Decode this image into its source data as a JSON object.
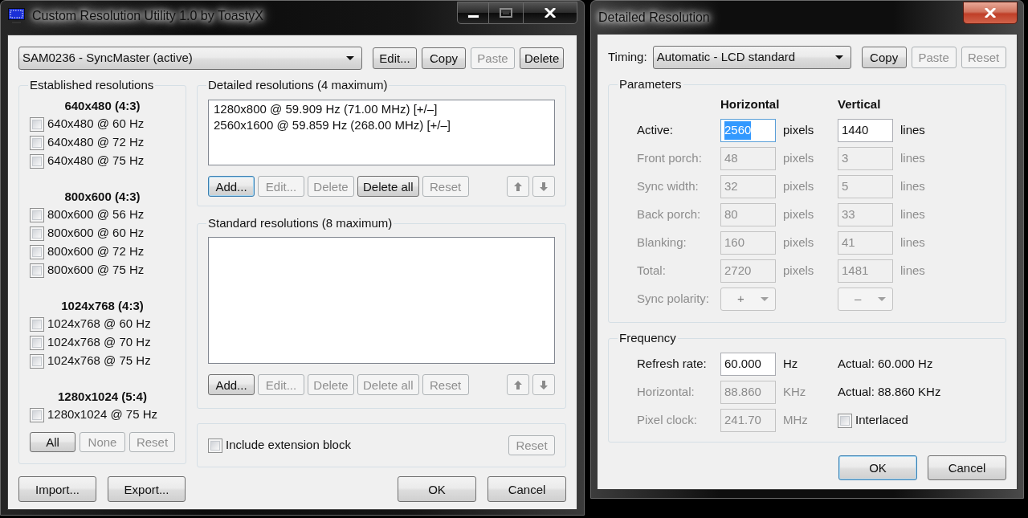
{
  "main_window": {
    "title": "Custom Resolution Utility 1.0 by ToastyX",
    "monitor_select": {
      "value": "SAM0236 - SyncMaster (active)"
    },
    "monitor_buttons": [
      {
        "label": "Edit...",
        "disabled": false
      },
      {
        "label": "Copy",
        "disabled": false
      },
      {
        "label": "Paste",
        "disabled": true
      },
      {
        "label": "Delete",
        "disabled": false
      }
    ],
    "established": {
      "title": "Established resolutions",
      "groups": [
        {
          "heading": "640x480 (4:3)",
          "items": [
            {
              "label": "640x480 @ 60 Hz",
              "checked": false
            },
            {
              "label": "640x480 @ 72 Hz",
              "checked": false
            },
            {
              "label": "640x480 @ 75 Hz",
              "checked": false
            }
          ]
        },
        {
          "heading": "800x600 (4:3)",
          "items": [
            {
              "label": "800x600 @ 56 Hz",
              "checked": false
            },
            {
              "label": "800x600 @ 60 Hz",
              "checked": false
            },
            {
              "label": "800x600 @ 72 Hz",
              "checked": false
            },
            {
              "label": "800x600 @ 75 Hz",
              "checked": false
            }
          ]
        },
        {
          "heading": "1024x768 (4:3)",
          "items": [
            {
              "label": "1024x768 @ 60 Hz",
              "checked": false
            },
            {
              "label": "1024x768 @ 70 Hz",
              "checked": false
            },
            {
              "label": "1024x768 @ 75 Hz",
              "checked": false
            }
          ]
        },
        {
          "heading": "1280x1024 (5:4)",
          "items": [
            {
              "label": "1280x1024 @ 75 Hz",
              "checked": false
            }
          ]
        }
      ],
      "buttons": [
        {
          "label": "All",
          "disabled": false
        },
        {
          "label": "None",
          "disabled": true
        },
        {
          "label": "Reset",
          "disabled": true
        }
      ]
    },
    "detailed": {
      "title": "Detailed resolutions (4 maximum)",
      "items": [
        {
          "label": "1280x800 @ 59.909 Hz (71.00 MHz) [+/–]",
          "selected": false
        },
        {
          "label": "2560x1600 @ 59.859 Hz (268.00 MHz) [+/–]",
          "selected": false
        }
      ],
      "buttons": [
        {
          "label": "Add...",
          "disabled": false,
          "focused": true
        },
        {
          "label": "Edit...",
          "disabled": true,
          "focused": false
        },
        {
          "label": "Delete",
          "disabled": true,
          "focused": false
        },
        {
          "label": "Delete all",
          "disabled": false,
          "focused": false
        },
        {
          "label": "Reset",
          "disabled": true,
          "focused": false
        }
      ],
      "move_buttons": [
        {
          "kind": "up",
          "disabled": true
        },
        {
          "kind": "down",
          "disabled": true
        }
      ]
    },
    "standard": {
      "title": "Standard resolutions (8 maximum)",
      "buttons": [
        {
          "label": "Add...",
          "disabled": false
        },
        {
          "label": "Edit...",
          "disabled": true
        },
        {
          "label": "Delete",
          "disabled": true
        },
        {
          "label": "Delete all",
          "disabled": true
        },
        {
          "label": "Reset",
          "disabled": true
        }
      ],
      "move_buttons": [
        {
          "kind": "up",
          "disabled": true
        },
        {
          "kind": "down",
          "disabled": true
        }
      ]
    },
    "extension": {
      "checkbox": {
        "label": "Include extension block",
        "checked": false
      },
      "reset": {
        "label": "Reset",
        "disabled": true
      }
    },
    "footer_left": [
      {
        "label": "Import..."
      },
      {
        "label": "Export..."
      }
    ],
    "footer_right": [
      {
        "label": "OK"
      },
      {
        "label": "Cancel"
      }
    ]
  },
  "detail_window": {
    "title": "Detailed Resolution",
    "timing": {
      "label": "Timing:",
      "value": "Automatic - LCD standard"
    },
    "buttons": [
      {
        "label": "Copy",
        "disabled": false
      },
      {
        "label": "Paste",
        "disabled": true
      },
      {
        "label": "Reset",
        "disabled": true
      }
    ],
    "parameters": {
      "title": "Parameters",
      "columns": [
        "Horizontal",
        "Vertical"
      ],
      "rows": [
        {
          "kind": "input",
          "label": "Active:",
          "disabled": false,
          "horizontal": {
            "value": "2560",
            "unit": "pixels",
            "text_selected": true
          },
          "vertical": {
            "value": "1440",
            "unit": "lines",
            "text_selected": false
          }
        },
        {
          "kind": "input",
          "label": "Front porch:",
          "disabled": true,
          "horizontal": {
            "value": "48",
            "unit": "pixels",
            "text_selected": false
          },
          "vertical": {
            "value": "3",
            "unit": "lines",
            "text_selected": false
          }
        },
        {
          "kind": "input",
          "label": "Sync width:",
          "disabled": true,
          "horizontal": {
            "value": "32",
            "unit": "pixels",
            "text_selected": false
          },
          "vertical": {
            "value": "5",
            "unit": "lines",
            "text_selected": false
          }
        },
        {
          "kind": "input",
          "label": "Back porch:",
          "disabled": true,
          "horizontal": {
            "value": "80",
            "unit": "pixels",
            "text_selected": false
          },
          "vertical": {
            "value": "33",
            "unit": "lines",
            "text_selected": false
          }
        },
        {
          "kind": "input",
          "label": "Blanking:",
          "disabled": true,
          "horizontal": {
            "value": "160",
            "unit": "pixels",
            "text_selected": false
          },
          "vertical": {
            "value": "41",
            "unit": "lines",
            "text_selected": false
          }
        },
        {
          "kind": "input",
          "label": "Total:",
          "disabled": true,
          "horizontal": {
            "value": "2720",
            "unit": "pixels",
            "text_selected": false
          },
          "vertical": {
            "value": "1481",
            "unit": "lines",
            "text_selected": false
          }
        },
        {
          "kind": "select",
          "label": "Sync polarity:",
          "disabled": true,
          "horizontal": {
            "value": "+"
          },
          "vertical": {
            "value": "–"
          }
        }
      ]
    },
    "frequency": {
      "title": "Frequency",
      "rows": [
        {
          "kind": "actual",
          "label": "Refresh rate:",
          "disabled": false,
          "value": "60.000",
          "unit": "Hz",
          "actual": "Actual: 60.000 Hz"
        },
        {
          "kind": "actual",
          "label": "Horizontal:",
          "disabled": true,
          "value": "88.860",
          "unit": "KHz",
          "actual": "Actual: 88.860 KHz"
        },
        {
          "kind": "checkbox",
          "label": "Pixel clock:",
          "disabled": true,
          "value": "241.70",
          "unit": "MHz",
          "checkbox": {
            "label": "Interlaced",
            "checked": false
          }
        }
      ]
    },
    "footer_buttons": [
      {
        "label": "OK",
        "focused": true
      },
      {
        "label": "Cancel",
        "focused": false
      }
    ]
  }
}
